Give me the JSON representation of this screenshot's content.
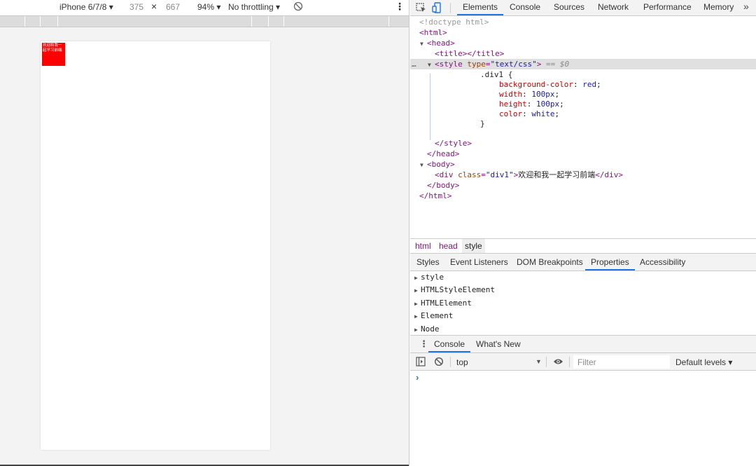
{
  "device_toolbar": {
    "device": "iPhone 6/7/8 ▾",
    "width": "375",
    "times": "×",
    "height": "667",
    "zoom": "94% ▾",
    "throttling": "No throttling ▾"
  },
  "page": {
    "div_text": "欢迎和我一起学习前端",
    "div_color": "#ff0000"
  },
  "devtools": {
    "tabs": [
      "Elements",
      "Console",
      "Sources",
      "Network",
      "Performance",
      "Memory"
    ],
    "more": "»",
    "elements": {
      "doctype": "<!doctype html>",
      "html_open": "<html>",
      "head_open": "<head>",
      "title_open": "<title>",
      "title_close": "</title>",
      "style_tag": "style",
      "style_attr": "type",
      "style_val": "\"text/css\"",
      "eq_marker": "== $0",
      "dots": "…",
      "css_selector": ".div1 {",
      "css_rules": [
        {
          "prop": "background-color",
          "value": "red"
        },
        {
          "prop": "width",
          "value": "100px"
        },
        {
          "prop": "height",
          "value": "100px"
        },
        {
          "prop": "color",
          "value": "white"
        }
      ],
      "css_close": "}",
      "style_close": "</style>",
      "head_close": "</head>",
      "body_open": "<body>",
      "div_tag": "div",
      "div_attr": "class",
      "div_val": "\"div1\"",
      "div_text": "欢迎和我一起学习前端",
      "div_close": "</div>",
      "body_close": "</body>",
      "html_close": "</html>"
    },
    "breadcrumbs": [
      "html",
      "head",
      "style"
    ],
    "subtabs": [
      "Styles",
      "Event Listeners",
      "DOM Breakpoints",
      "Properties",
      "Accessibility"
    ],
    "properties": [
      "style",
      "HTMLStyleElement",
      "HTMLElement",
      "Element",
      "Node"
    ],
    "drawer_tabs": [
      "Console",
      "What's New"
    ],
    "console_toolbar": {
      "context": "top",
      "filter_placeholder": "Filter",
      "levels": "Default levels ▾"
    },
    "prompt": "›"
  },
  "colors": {
    "accent": "#1a73e8",
    "tag": "#881280",
    "attr": "#994500",
    "value": "#1a1aa6",
    "css_prop": "#c80000"
  }
}
